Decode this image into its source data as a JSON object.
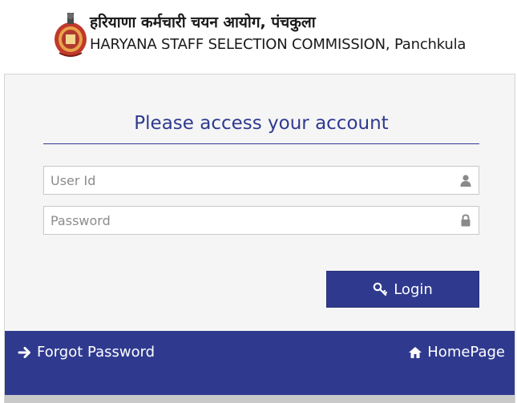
{
  "header": {
    "title_hindi": "हरियाणा कर्मचारी चयन आयोग, पंचकुला",
    "title_english": "HARYANA STAFF SELECTION COMMISSION, Panchkula",
    "emblem_icon": "haryana-emblem-icon"
  },
  "login": {
    "heading": "Please access your account",
    "userid_placeholder": "User Id",
    "userid_value": "",
    "userid_icon": "user-icon",
    "password_placeholder": "Password",
    "password_value": "",
    "password_icon": "lock-icon",
    "button_label": "Login",
    "button_icon": "key-icon"
  },
  "footer": {
    "forgot_label": "Forgot Password",
    "forgot_icon": "arrow-right-icon",
    "home_label": "HomePage",
    "home_icon": "home-icon"
  },
  "colors": {
    "primary": "#2f3a8f",
    "panel_bg": "#f5f5f5",
    "emblem_red": "#c0392b"
  }
}
